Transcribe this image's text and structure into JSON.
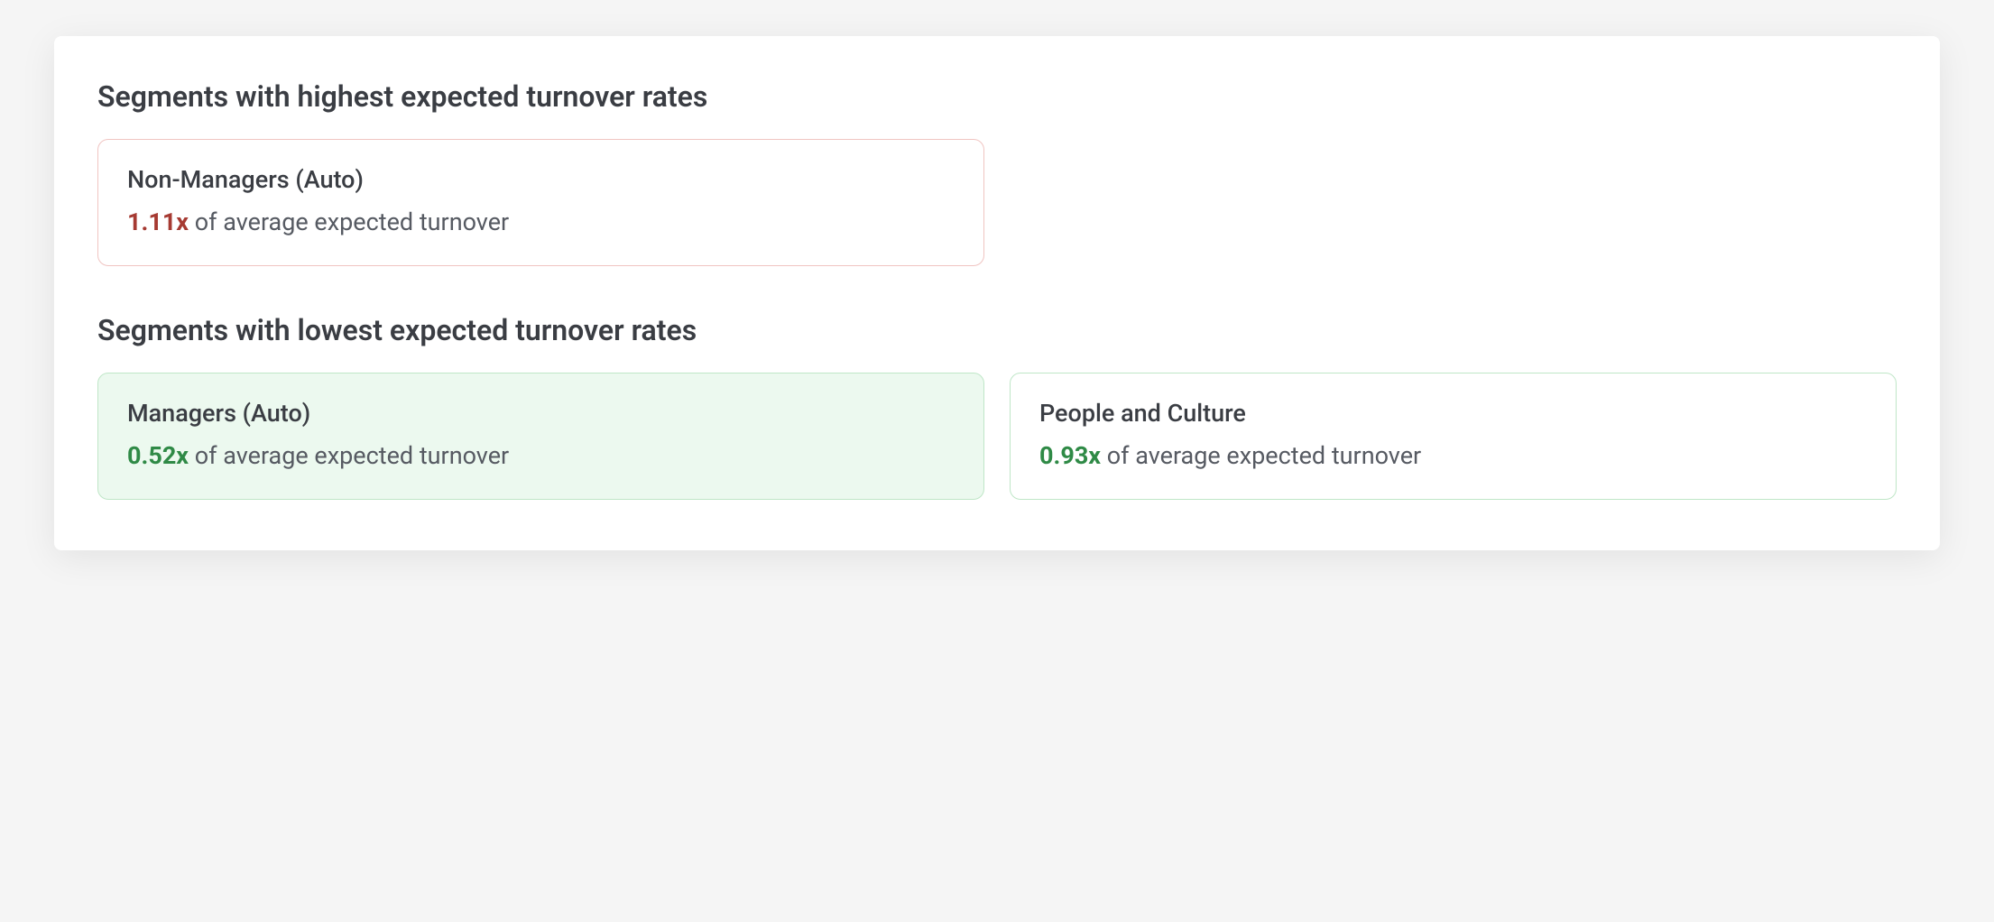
{
  "sections": {
    "highest": {
      "title": "Segments with highest expected turnover rates",
      "cards": [
        {
          "name": "Non-Managers (Auto)",
          "multiplier": "1.11x",
          "suffix": " of average expected turnover"
        }
      ]
    },
    "lowest": {
      "title": "Segments with lowest expected turnover rates",
      "cards": [
        {
          "name": "Managers (Auto)",
          "multiplier": "0.52x",
          "suffix": " of average expected turnover"
        },
        {
          "name": "People and Culture",
          "multiplier": "0.93x",
          "suffix": " of average expected turnover"
        }
      ]
    }
  }
}
